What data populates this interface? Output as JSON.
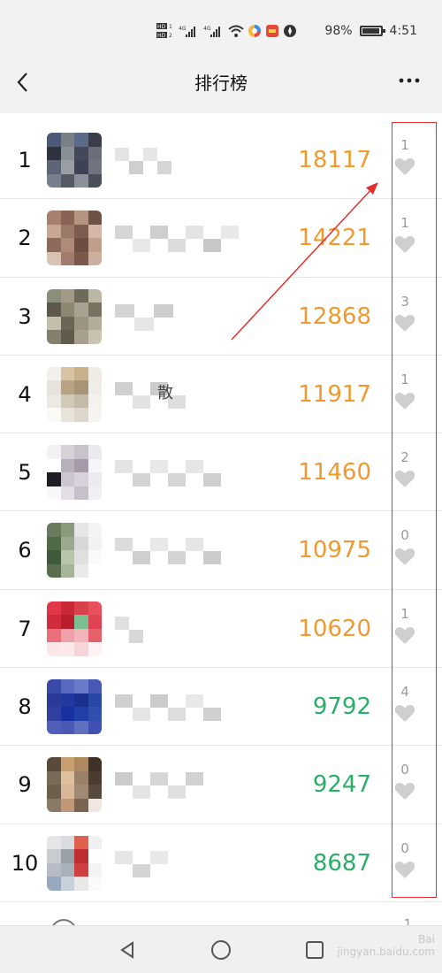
{
  "status_bar": {
    "network_left": "HD 4G 4G",
    "battery": "98%",
    "time": "4:51"
  },
  "nav": {
    "back_icon": "chevron-left-icon",
    "title": "排行榜",
    "more_icon": "more-dots-icon"
  },
  "colors": {
    "steps_high": "#ef9a31",
    "steps_low": "#2aae68",
    "highlight_box": "#e03030"
  },
  "ranking": [
    {
      "rank": "1",
      "steps": "18117",
      "likes": "1",
      "tone": "orange",
      "name": ""
    },
    {
      "rank": "2",
      "steps": "14221",
      "likes": "1",
      "tone": "orange",
      "name": ""
    },
    {
      "rank": "3",
      "steps": "12868",
      "likes": "3",
      "tone": "orange",
      "name": ""
    },
    {
      "rank": "4",
      "steps": "11917",
      "likes": "1",
      "tone": "orange",
      "name": "散"
    },
    {
      "rank": "5",
      "steps": "11460",
      "likes": "2",
      "tone": "orange",
      "name": ""
    },
    {
      "rank": "6",
      "steps": "10975",
      "likes": "0",
      "tone": "orange",
      "name": ""
    },
    {
      "rank": "7",
      "steps": "10620",
      "likes": "1",
      "tone": "orange",
      "name": ""
    },
    {
      "rank": "8",
      "steps": "9792",
      "likes": "4",
      "tone": "green",
      "name": ""
    },
    {
      "rank": "9",
      "steps": "9247",
      "likes": "0",
      "tone": "green",
      "name": ""
    },
    {
      "rank": "10",
      "steps": "8687",
      "likes": "0",
      "tone": "green",
      "name": ""
    }
  ],
  "partial_row": {
    "likes": "1"
  },
  "watermark": {
    "line1": "Bai",
    "line2": "jingyan.baidu.com"
  }
}
